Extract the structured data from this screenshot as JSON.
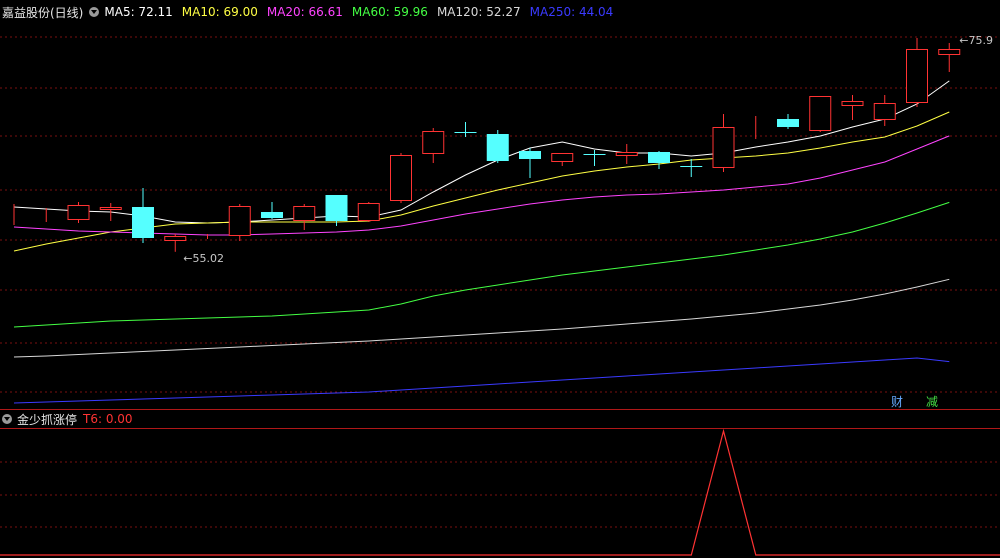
{
  "header": {
    "title": "嘉益股份(日线)",
    "indicators": [
      {
        "label": "MA5: 72.11",
        "color": "#ffffff"
      },
      {
        "label": "MA10: 69.00",
        "color": "#ffff44"
      },
      {
        "label": "MA20: 66.61",
        "color": "#ff44ff"
      },
      {
        "label": "MA60: 59.96",
        "color": "#44ff44"
      },
      {
        "label": "MA120: 52.27",
        "color": "#d8d8d8"
      },
      {
        "label": "MA250: 44.04",
        "color": "#3a3aff"
      }
    ]
  },
  "sub_header": {
    "title": "金少抓涨停",
    "value_label": "T6: 0.00",
    "value_color": "#ff3333"
  },
  "badges": [
    {
      "text": "财",
      "color": "#66aaff"
    },
    {
      "text": "减",
      "color": "#44dd44"
    }
  ],
  "chart_data": [
    {
      "type": "candlestick",
      "title": "嘉益股份(日线)",
      "price_range": [
        39.6,
        78.0
      ],
      "grid": "dotted horizontal red",
      "up_color": "#ff3333",
      "down_color": "#55ffff",
      "candles": [
        {
          "o": 58.9,
          "h": 59.8,
          "l": 57.7,
          "c": 58.9
        },
        {
          "o": 58.9,
          "h": 59.4,
          "l": 58.0,
          "c": 58.9
        },
        {
          "o": 58.2,
          "h": 60.0,
          "l": 57.9,
          "c": 59.7
        },
        {
          "o": 59.2,
          "h": 59.9,
          "l": 58.1,
          "c": 59.5
        },
        {
          "o": 59.5,
          "h": 61.4,
          "l": 55.9,
          "c": 56.4
        },
        {
          "o": 56.1,
          "h": 56.8,
          "l": 55.02,
          "c": 56.6
        },
        {
          "o": 56.6,
          "h": 56.8,
          "l": 56.3,
          "c": 56.6
        },
        {
          "o": 56.6,
          "h": 59.8,
          "l": 56.1,
          "c": 59.6
        },
        {
          "o": 59.0,
          "h": 60.0,
          "l": 58.3,
          "c": 58.4
        },
        {
          "o": 58.1,
          "h": 59.8,
          "l": 57.2,
          "c": 59.6
        },
        {
          "o": 60.7,
          "h": 60.7,
          "l": 57.6,
          "c": 58.1
        },
        {
          "o": 58.1,
          "h": 60.0,
          "l": 58.0,
          "c": 59.9
        },
        {
          "o": 60.1,
          "h": 64.9,
          "l": 59.9,
          "c": 64.7
        },
        {
          "o": 64.8,
          "h": 67.4,
          "l": 63.9,
          "c": 67.1
        },
        {
          "o": 67.0,
          "h": 68.0,
          "l": 66.5,
          "c": 66.9
        },
        {
          "o": 66.8,
          "h": 67.2,
          "l": 63.9,
          "c": 64.1
        },
        {
          "o": 65.1,
          "h": 65.4,
          "l": 62.4,
          "c": 64.3
        },
        {
          "o": 64.0,
          "h": 64.9,
          "l": 63.6,
          "c": 64.9
        },
        {
          "o": 64.8,
          "h": 65.2,
          "l": 63.6,
          "c": 64.7
        },
        {
          "o": 64.6,
          "h": 65.8,
          "l": 63.8,
          "c": 65.0
        },
        {
          "o": 65.0,
          "h": 65.1,
          "l": 63.3,
          "c": 63.9
        },
        {
          "o": 63.6,
          "h": 64.3,
          "l": 62.5,
          "c": 63.5
        },
        {
          "o": 63.4,
          "h": 68.8,
          "l": 63.0,
          "c": 67.5
        },
        {
          "o": 67.8,
          "h": 68.6,
          "l": 66.3,
          "c": 67.8
        },
        {
          "o": 68.3,
          "h": 68.8,
          "l": 67.3,
          "c": 67.5
        },
        {
          "o": 67.1,
          "h": 70.6,
          "l": 67.0,
          "c": 70.6
        },
        {
          "o": 69.6,
          "h": 70.7,
          "l": 68.2,
          "c": 70.1
        },
        {
          "o": 68.2,
          "h": 70.7,
          "l": 67.6,
          "c": 69.9
        },
        {
          "o": 69.9,
          "h": 76.4,
          "l": 69.5,
          "c": 75.3
        },
        {
          "o": 74.7,
          "h": 75.9,
          "l": 73.0,
          "c": 75.3
        }
      ],
      "ma_lines": [
        {
          "name": "MA5",
          "color": "#ffffff",
          "values": [
            59.5,
            59.3,
            59.1,
            59.0,
            58.6,
            58.0,
            57.9,
            58.0,
            58.2,
            58.4,
            58.6,
            58.5,
            59.2,
            61.0,
            62.7,
            64.2,
            65.4,
            66.0,
            65.3,
            64.9,
            64.9,
            64.6,
            64.9,
            65.5,
            66.0,
            66.6,
            67.5,
            68.3,
            69.8,
            72.11
          ]
        },
        {
          "name": "MA10",
          "color": "#ffff44",
          "values": [
            55.1,
            55.8,
            56.4,
            57.0,
            57.4,
            57.8,
            57.9,
            58.0,
            58.0,
            58.0,
            58.0,
            58.1,
            58.7,
            59.6,
            60.4,
            61.2,
            61.9,
            62.6,
            63.1,
            63.5,
            63.8,
            64.2,
            64.4,
            64.6,
            64.9,
            65.4,
            66.0,
            66.5,
            67.6,
            69.0
          ]
        },
        {
          "name": "MA20",
          "color": "#ff44ff",
          "values": [
            57.5,
            57.3,
            57.1,
            57.0,
            56.9,
            56.8,
            56.7,
            56.7,
            56.8,
            56.9,
            57.0,
            57.2,
            57.6,
            58.2,
            58.8,
            59.3,
            59.8,
            60.2,
            60.5,
            60.7,
            60.8,
            61.0,
            61.2,
            61.5,
            61.8,
            62.4,
            63.2,
            64.0,
            65.3,
            66.61
          ]
        },
        {
          "name": "MA60",
          "color": "#44ff44",
          "values": [
            47.5,
            47.7,
            47.9,
            48.1,
            48.2,
            48.3,
            48.4,
            48.5,
            48.6,
            48.8,
            49.0,
            49.2,
            49.8,
            50.6,
            51.2,
            51.7,
            52.2,
            52.7,
            53.1,
            53.5,
            53.9,
            54.3,
            54.7,
            55.2,
            55.7,
            56.3,
            57.0,
            57.9,
            58.9,
            59.96
          ]
        },
        {
          "name": "MA120",
          "color": "#d8d8d8",
          "values": [
            44.5,
            44.6,
            44.75,
            44.9,
            45.05,
            45.2,
            45.35,
            45.5,
            45.65,
            45.8,
            45.95,
            46.1,
            46.3,
            46.5,
            46.7,
            46.9,
            47.1,
            47.3,
            47.55,
            47.8,
            48.05,
            48.3,
            48.6,
            48.9,
            49.3,
            49.7,
            50.2,
            50.8,
            51.5,
            52.27
          ]
        },
        {
          "name": "MA250",
          "color": "#3a3aff",
          "values": [
            39.9,
            40.0,
            40.1,
            40.2,
            40.3,
            40.4,
            40.5,
            40.6,
            40.7,
            40.8,
            40.9,
            41.0,
            41.2,
            41.4,
            41.6,
            41.8,
            42.0,
            42.2,
            42.4,
            42.6,
            42.8,
            43.0,
            43.2,
            43.4,
            43.6,
            43.8,
            44.0,
            44.2,
            44.4,
            44.04
          ]
        }
      ],
      "annotations": [
        {
          "text": "55.02",
          "candle": 5,
          "price": 55.02,
          "position": "low"
        },
        {
          "text": "75.9",
          "candle": 29,
          "price": 75.9,
          "position": "high"
        }
      ]
    },
    {
      "type": "line",
      "title": "金少抓涨停",
      "series": [
        {
          "name": "T6",
          "color": "#ff3333",
          "values": [
            0,
            0,
            0,
            0,
            0,
            0,
            0,
            0,
            0,
            0,
            0,
            0,
            0,
            0,
            0,
            0,
            0,
            0,
            0,
            0,
            0,
            0,
            1,
            0,
            0,
            0,
            0,
            0,
            0,
            0
          ]
        }
      ],
      "ylim": [
        0,
        1
      ]
    }
  ]
}
